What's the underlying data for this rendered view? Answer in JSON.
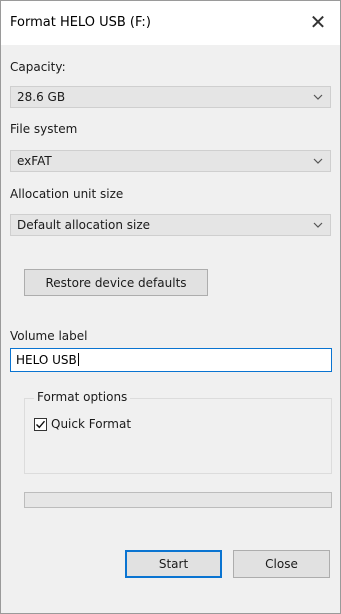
{
  "window": {
    "title": "Format HELO USB (F:)",
    "close_glyph": "✕"
  },
  "capacity": {
    "label": "Capacity:",
    "value": "28.6 GB"
  },
  "file_system": {
    "label": "File system",
    "value": "exFAT"
  },
  "allocation": {
    "label": "Allocation unit size",
    "value": "Default allocation size"
  },
  "restore_button": {
    "label": "Restore device defaults"
  },
  "volume": {
    "label": "Volume label",
    "value": "HELO USB"
  },
  "format_options": {
    "title": "Format options",
    "quick_format_label": "Quick Format",
    "quick_format_checked": true
  },
  "progress": {
    "fraction": 0
  },
  "buttons": {
    "start": "Start",
    "close": "Close"
  },
  "colors": {
    "accent": "#0a74d1",
    "dialog_bg": "#f0f0f0",
    "progress_fill": "#06b025"
  },
  "icons": {
    "dropdown": "chevron-down-icon",
    "checkbox": "check-icon",
    "close": "close-icon"
  }
}
